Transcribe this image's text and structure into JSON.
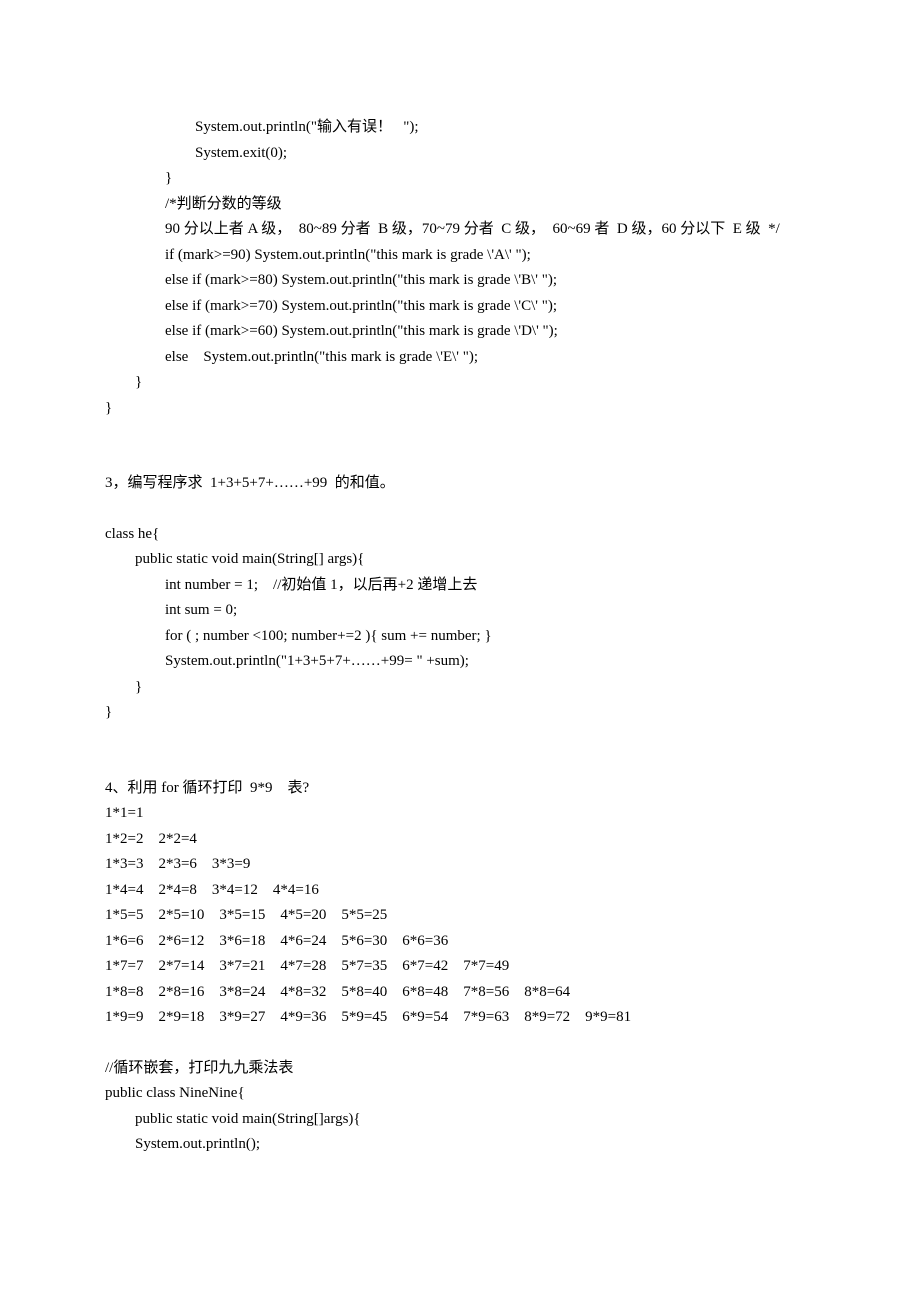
{
  "block1": {
    "l1": "                        System.out.println(\"输入有误！   \");",
    "l2": "                        System.exit(0);",
    "l3": "                }",
    "l4": "                /*判断分数的等级",
    "l5": "                90 分以上者 A 级，  80~89 分者  B 级，70~79 分者  C 级，  60~69 者  D 级，60 分以下  E 级  */",
    "l6": "                if (mark>=90) System.out.println(\"this mark is grade \\'A\\' \");",
    "l7": "                else if (mark>=80) System.out.println(\"this mark is grade \\'B\\' \");",
    "l8": "                else if (mark>=70) System.out.println(\"this mark is grade \\'C\\' \");",
    "l9": "                else if (mark>=60) System.out.println(\"this mark is grade \\'D\\' \");",
    "l10": "                else    System.out.println(\"this mark is grade \\'E\\' \");",
    "l11": "        }",
    "l12": "}"
  },
  "block2": {
    "h": "3，编写程序求  1+3+5+7+……+99  的和值。",
    "l1": "class he{",
    "l2": "        public static void main(String[] args){",
    "l3": "                int number = 1;    //初始值 1，以后再+2 递增上去",
    "l4": "                int sum = 0;",
    "l5": "                for ( ; number <100; number+=2 ){ sum += number; }",
    "l6": "                System.out.println(\"1+3+5+7+……+99= \" +sum);",
    "l7": "        }",
    "l8": "}"
  },
  "block3": {
    "h": "4、利用 for 循环打印  9*9    表?",
    "l1": "1*1=1",
    "l2": "1*2=2    2*2=4",
    "l3": "1*3=3    2*3=6    3*3=9",
    "l4": "1*4=4    2*4=8    3*4=12    4*4=16",
    "l5": "1*5=5    2*5=10    3*5=15    4*5=20    5*5=25",
    "l6": "1*6=6    2*6=12    3*6=18    4*6=24    5*6=30    6*6=36",
    "l7": "1*7=7    2*7=14    3*7=21    4*7=28    5*7=35    6*7=42    7*7=49",
    "l8": "1*8=8    2*8=16    3*8=24    4*8=32    5*8=40    6*8=48    7*8=56    8*8=64",
    "l9": "1*9=9    2*9=18    3*9=27    4*9=36    5*9=45    6*9=54    7*9=63    8*9=72    9*9=81"
  },
  "block4": {
    "l1": "//循环嵌套，打印九九乘法表",
    "l2": "public class NineNine{",
    "l3": "        public static void main(String[]args){",
    "l4": "        System.out.println();"
  }
}
